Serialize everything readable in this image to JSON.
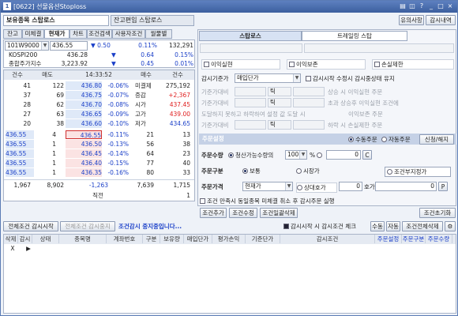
{
  "window": {
    "title": "[0622] 선물옵션Stoploss",
    "icons": [
      "stock-icon",
      "minimize-icon",
      "maximize-icon",
      "close-icon"
    ]
  },
  "header": {
    "tab1": "보유종목 스탑로스",
    "tab2": "잔고편입 스탑로스",
    "btn_notice": "유의사항",
    "btn_monitor": "감시내역"
  },
  "subtabs": [
    "잔고",
    "미체결",
    "현재가",
    "차트",
    "조건검색",
    "사용자조건",
    "월물별"
  ],
  "quote": {
    "code": "101W9000",
    "dd": "▼",
    "name": "436.55",
    "change": "▼ 0.50",
    "pct": "0.11%",
    "volume": "132,291",
    "row2": {
      "label": "KOSPI200",
      "value": "436.28",
      "chg": "▼",
      "chgval": "0.64",
      "pct": "0.15%"
    },
    "row3": {
      "label": "종합주가지수",
      "value": "3,223.92",
      "chg": "▼",
      "chgval": "0.45",
      "pct": "0.01%"
    }
  },
  "book": {
    "hdr": {
      "count": "건수",
      "ask": "매도",
      "time": "14:33:52",
      "bid": "매수",
      "count2": "건수"
    },
    "asks": [
      {
        "cnt": "41",
        "qty": "122",
        "price": "436.80",
        "pct": "-0.06%"
      },
      {
        "cnt": "37",
        "qty": "69",
        "price": "436.75",
        "pct": "-0.07%"
      },
      {
        "cnt": "28",
        "qty": "62",
        "price": "436.70",
        "pct": "-0.08%"
      },
      {
        "cnt": "27",
        "qty": "63",
        "price": "436.65",
        "pct": "-0.09%"
      },
      {
        "cnt": "20",
        "qty": "38",
        "price": "436.60",
        "pct": "-0.10%"
      }
    ],
    "info": [
      {
        "k": "미결제",
        "v": "275,192"
      },
      {
        "k": "증감",
        "v": "+2,367"
      },
      {
        "k": "시가",
        "v": "437.45"
      },
      {
        "k": "고가",
        "v": "439.00"
      },
      {
        "k": "저가",
        "v": "434.65"
      }
    ],
    "left": [
      {
        "a": "436.55",
        "b": "4"
      },
      {
        "a": "436.55",
        "b": "1"
      },
      {
        "a": "436.55",
        "b": "1"
      },
      {
        "a": "436.55",
        "b": "1"
      },
      {
        "a": "436.55",
        "b": "1"
      }
    ],
    "bids": [
      {
        "price": "436.55",
        "pct": "-0.11%",
        "qty": "21",
        "cnt": "13"
      },
      {
        "price": "436.50",
        "pct": "-0.13%",
        "qty": "56",
        "cnt": "38"
      },
      {
        "price": "436.45",
        "pct": "-0.14%",
        "qty": "64",
        "cnt": "23"
      },
      {
        "price": "436.40",
        "pct": "-0.15%",
        "qty": "77",
        "cnt": "40"
      },
      {
        "price": "436.35",
        "pct": "-0.16%",
        "qty": "80",
        "cnt": "33"
      }
    ],
    "totals": {
      "c1": "1,967",
      "c2": "8,902",
      "c3": "-1,263",
      "c4": "7,639",
      "c5": "1,715"
    },
    "last_label": "직전",
    "last_val": "1"
  },
  "right": {
    "tab1": "스탑로스",
    "tab2": "트레일링 스탑",
    "opt1": "이익실현",
    "opt2": "이익보존",
    "opt3": "손실제한",
    "watch_label": "감시기준가",
    "watch_value": "매입단가",
    "chk_label": "감시시작 수정시 감시중상태 유지",
    "unit": "틱",
    "lines": [
      {
        "l": "기준가대비",
        "t": "상승 시 이익실현 주문"
      },
      {
        "l": "기준가대비",
        "t": "초과 상승후 이익실현 조건에"
      },
      {
        "l": "도달하지 못하고 하락하여 설정 값 도달 시",
        "t": "이익보존 주문"
      },
      {
        "l": "기준가대비",
        "t": "하락 시 손실제한 주문"
      }
    ],
    "order_settings": "주문설정",
    "manual": "수동주문",
    "auto": "자동주문",
    "apply_btn": "신청/해지",
    "qty_label": "주문수량",
    "qty_radio": "청산가능수량의",
    "qty_val": "100",
    "qty_unit": "%",
    "type_label": "주문구분",
    "type1": "보통",
    "type2": "시장가",
    "type3": "조건부지정가",
    "price_label": "주문가격",
    "price_val": "현재가",
    "hoga1": "상대호가",
    "hoga2": "호가",
    "hoga_val": "0",
    "p_btn": "P",
    "cond_chk": "조건 만족시 동일종목 미체결 취소 후 감시주문 실행",
    "btn_add": "조건추가",
    "btn_edit": "조건수정",
    "btn_delall": "조건일괄삭제",
    "btn_reset": "조건초기화"
  },
  "bottom": {
    "b1": "전체조건 감시시작",
    "b2": "전체조건 감시중지",
    "status": "조건감시 중지중입니다...",
    "chk": "감시시작 시 감시조건 체크",
    "b3": "수동",
    "b4": "자동",
    "b5": "조건전체삭제",
    "cols": [
      "삭제",
      "감시",
      "상태",
      "종목명",
      "계좌번호",
      "구분",
      "보유량",
      "매입단가",
      "평가손익",
      "기준단가",
      "감시조건",
      "주문설정",
      "주문구분",
      "주문수량"
    ],
    "row": [
      "X",
      "▶"
    ]
  }
}
